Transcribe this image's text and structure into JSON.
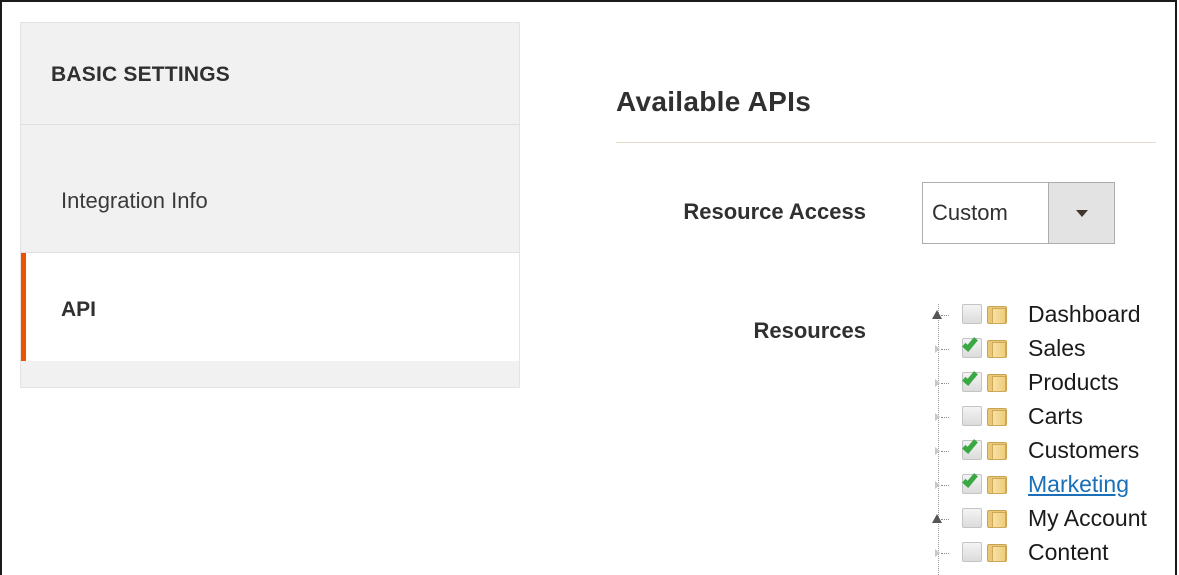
{
  "sidebar": {
    "title": "BASIC SETTINGS",
    "items": [
      {
        "label": "Integration Info"
      },
      {
        "label": "API"
      }
    ],
    "active_accent": "#eb5202"
  },
  "main": {
    "section_title": "Available APIs",
    "resource_access": {
      "label": "Resource Access",
      "selected": "Custom"
    },
    "resources": {
      "label": "Resources",
      "tree": [
        {
          "label": "Dashboard",
          "checked": false,
          "expandable": true,
          "link": false
        },
        {
          "label": "Sales",
          "checked": true,
          "expandable": false,
          "link": false
        },
        {
          "label": "Products",
          "checked": true,
          "expandable": false,
          "link": false
        },
        {
          "label": "Carts",
          "checked": false,
          "expandable": false,
          "link": false
        },
        {
          "label": "Customers",
          "checked": true,
          "expandable": false,
          "link": false
        },
        {
          "label": "Marketing",
          "checked": true,
          "expandable": false,
          "link": true
        },
        {
          "label": "My Account",
          "checked": false,
          "expandable": true,
          "link": false
        },
        {
          "label": "Content",
          "checked": false,
          "expandable": false,
          "link": false
        }
      ]
    }
  },
  "colors": {
    "check_green": "#3aa843",
    "link_blue": "#1a6fb7"
  }
}
